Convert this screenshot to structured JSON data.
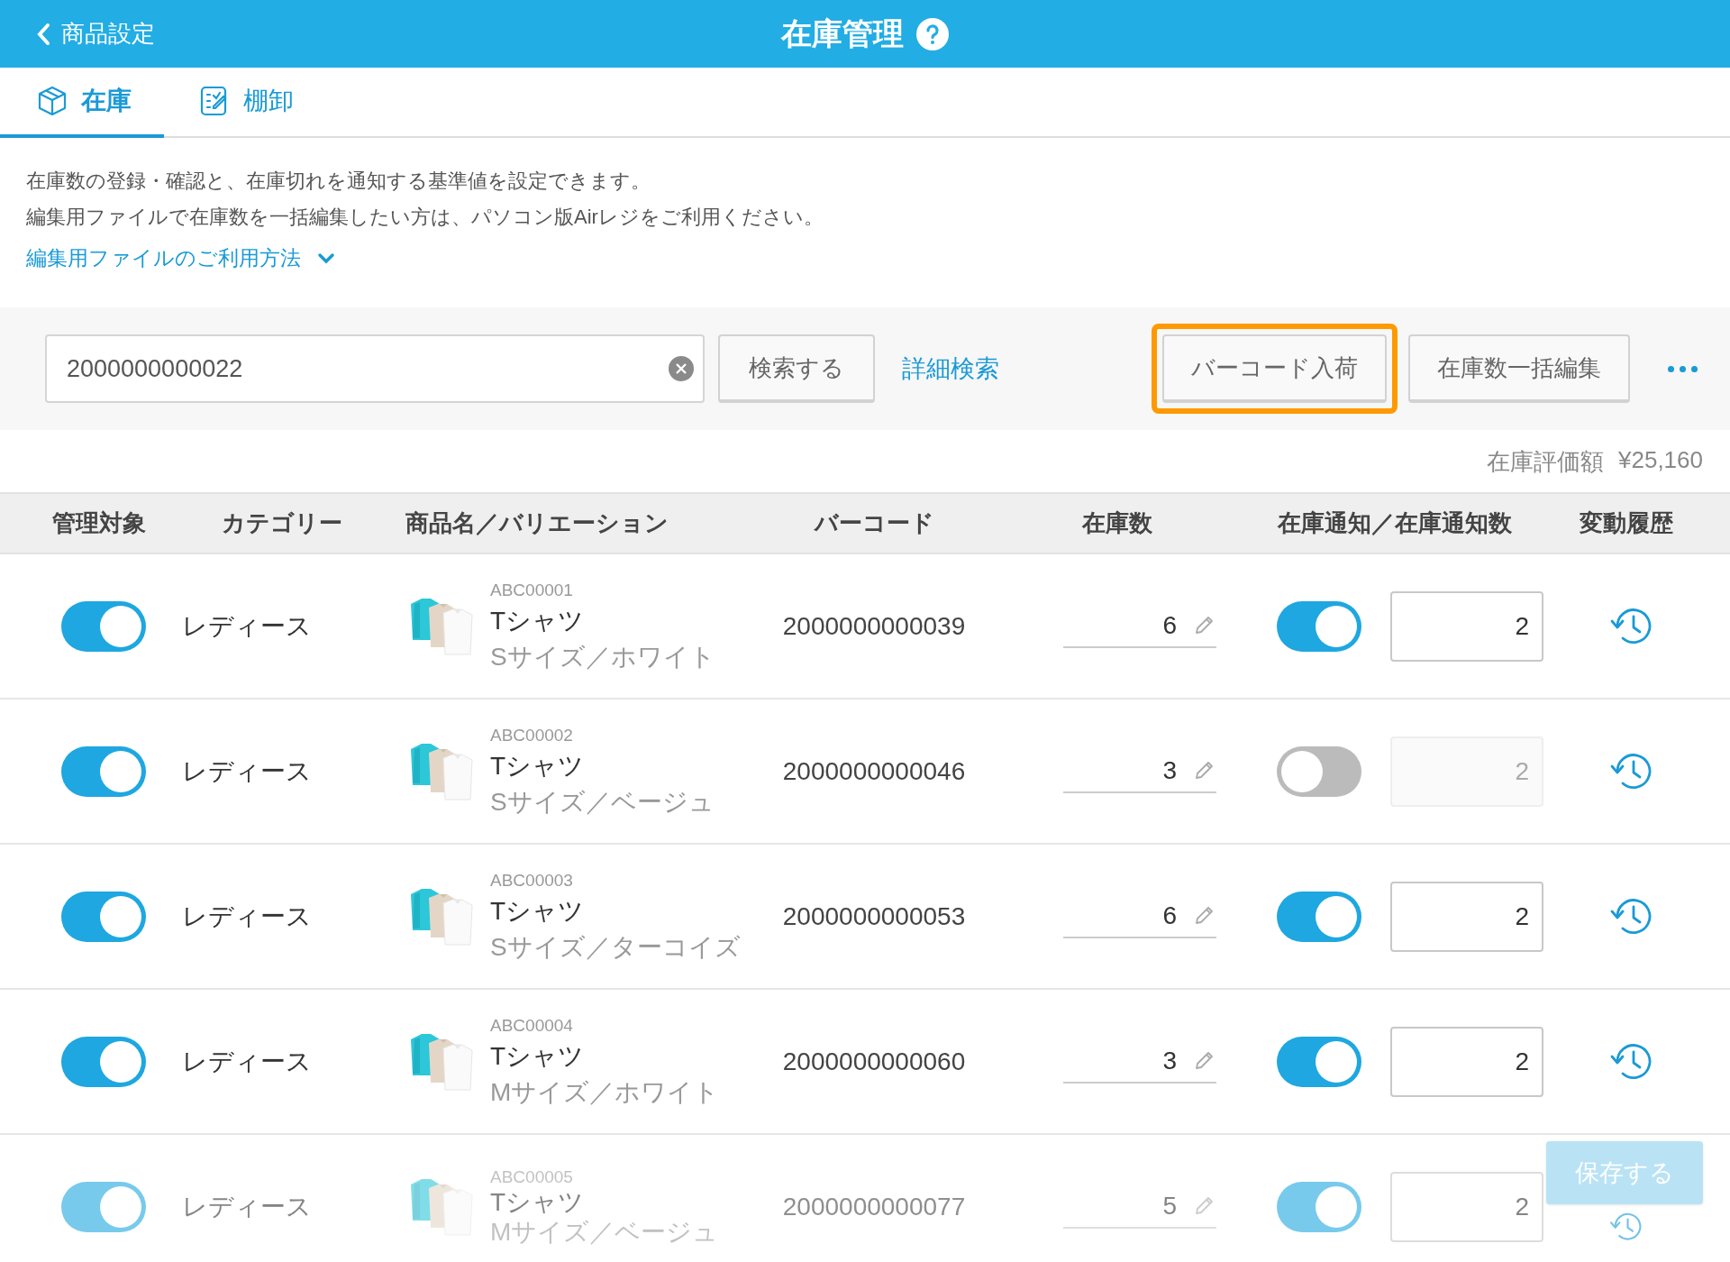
{
  "header": {
    "back_label": "商品設定",
    "title": "在庫管理"
  },
  "tabs": [
    {
      "label": "在庫",
      "kind": "box",
      "selected": true
    },
    {
      "label": "棚卸",
      "kind": "checklist",
      "selected": false
    }
  ],
  "description": [
    "在庫数の登録・確認と、在庫切れを通知する基準値を設定できます。",
    "編集用ファイルで在庫数を一括編集したい方は、パソコン版Airレジをご利用ください。"
  ],
  "help_link": "編集用ファイルのご利用方法",
  "search": {
    "value": "2000000000022",
    "search_button": "検索する",
    "advanced_link": "詳細検索"
  },
  "actions": [
    {
      "label": "バーコード入荷",
      "highlighted": true
    },
    {
      "label": "在庫数一括編集",
      "highlighted": false
    }
  ],
  "inventory_value": {
    "label": "在庫評価額",
    "value": "¥25,160"
  },
  "table": {
    "columns": [
      "管理対象",
      "カテゴリー",
      "商品名／バリエーション",
      "バーコード",
      "在庫数",
      "在庫通知／在庫通知数",
      "変動履歴"
    ],
    "rows": [
      {
        "managed": true,
        "category": "レディース",
        "code": "ABC00001",
        "name": "Tシャツ",
        "variation": "Sサイズ／ホワイト",
        "barcode": "2000000000039",
        "stock": "6",
        "notify": true,
        "notify_count": "2"
      },
      {
        "managed": true,
        "category": "レディース",
        "code": "ABC00002",
        "name": "Tシャツ",
        "variation": "Sサイズ／ベージュ",
        "barcode": "2000000000046",
        "stock": "3",
        "notify": false,
        "notify_count": "2"
      },
      {
        "managed": true,
        "category": "レディース",
        "code": "ABC00003",
        "name": "Tシャツ",
        "variation": "Sサイズ／ターコイズ",
        "barcode": "2000000000053",
        "stock": "6",
        "notify": true,
        "notify_count": "2"
      },
      {
        "managed": true,
        "category": "レディース",
        "code": "ABC00004",
        "name": "Tシャツ",
        "variation": "Mサイズ／ホワイト",
        "barcode": "2000000000060",
        "stock": "3",
        "notify": true,
        "notify_count": "2"
      },
      {
        "managed": true,
        "category": "レディース",
        "code": "ABC00005",
        "name": "Tシャツ",
        "variation": "Mサイズ／ベージュ",
        "barcode": "2000000000077",
        "stock": "5",
        "notify": true,
        "notify_count": "2"
      }
    ]
  },
  "save_button": {
    "label": "保存する",
    "disabled": true
  }
}
